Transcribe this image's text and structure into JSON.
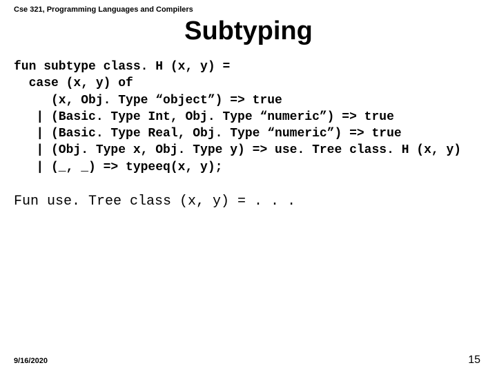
{
  "header": {
    "course": "Cse 321, Programming Languages and Compilers"
  },
  "title": "Subtyping",
  "code": {
    "l1": "fun subtype class. H (x, y) =",
    "l2": "  case (x, y) of",
    "l3": "     (x, Obj. Type “object”) => true",
    "l4": "   | (Basic. Type Int, Obj. Type “numeric”) => true",
    "l5": "   | (Basic. Type Real, Obj. Type “numeric”) => true",
    "l6": "   | (Obj. Type x, Obj. Type y) => use. Tree class. H (x, y)",
    "l7": "   | (_, _) => typeeq(x, y);"
  },
  "func_line": "Fun use. Tree class (x, y) = . . .",
  "footer": {
    "date": "9/16/2020",
    "page": "15"
  }
}
